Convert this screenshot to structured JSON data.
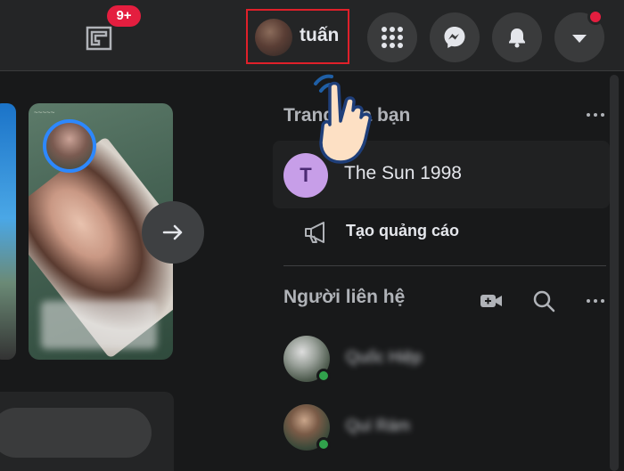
{
  "topbar": {
    "gaming_badge": "9+",
    "profile_name": "tuấn",
    "buttons": [
      "menu-grid-icon",
      "messenger-icon",
      "bell-icon",
      "caret-down-icon"
    ]
  },
  "right_panel": {
    "pages_heading": "Trang của bạn",
    "page_name": "The Sun 1998",
    "page_initial": "T",
    "create_ad_label": "Tạo quảng cáo",
    "contacts_heading": "Người liên hệ",
    "contacts": [
      {
        "name": "Quốc Hiệp",
        "online": true
      },
      {
        "name": "Quí Rám",
        "online": true
      }
    ]
  },
  "stories": {
    "card_name": "Nguyễn Thị Mỹ Thuận"
  },
  "colors": {
    "background": "#18191a",
    "surface": "#242526",
    "accent": "#2d88ff",
    "badge": "#e41e3f",
    "online": "#31a24c",
    "highlight_box": "#e0202a"
  }
}
